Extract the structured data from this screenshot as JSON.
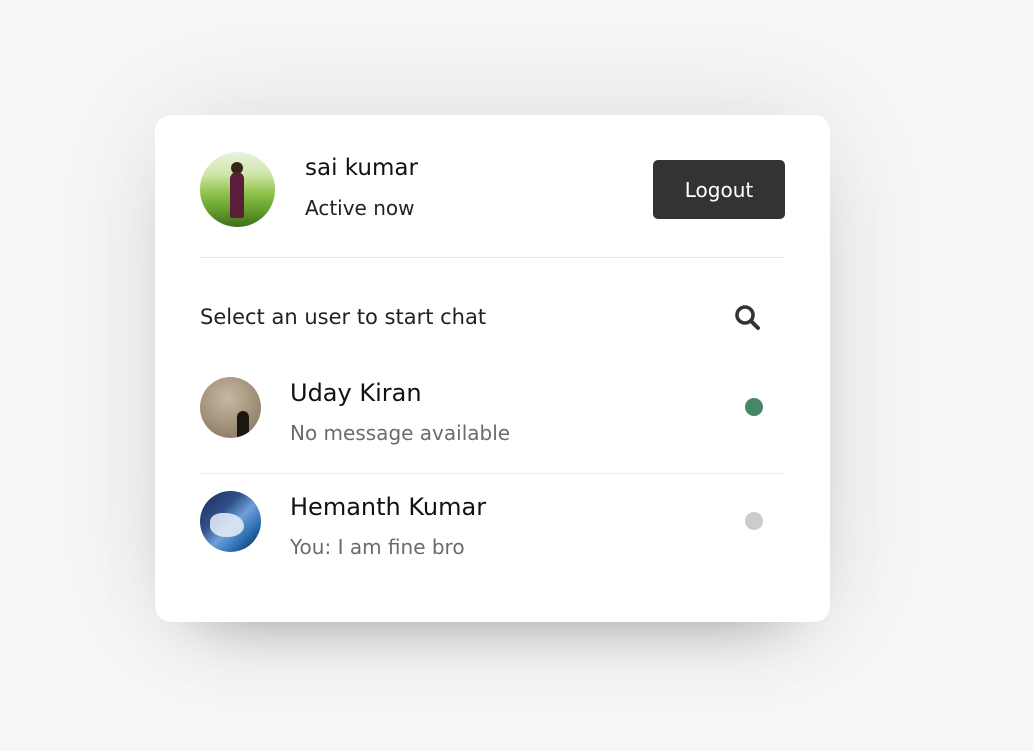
{
  "current_user": {
    "name": "sai kumar",
    "status": "Active now"
  },
  "header": {
    "logout_label": "Logout"
  },
  "search": {
    "label": "Select an user to start chat",
    "icon": "search-icon"
  },
  "users": [
    {
      "name": "Uday Kiran",
      "last_message": "No message available",
      "status": "online",
      "status_color": "#468669"
    },
    {
      "name": "Hemanth Kumar",
      "last_message": "You: I am fine bro",
      "status": "offline",
      "status_color": "#cccccc"
    }
  ],
  "colors": {
    "button_bg": "#333333",
    "online": "#468669",
    "offline": "#cccccc"
  }
}
